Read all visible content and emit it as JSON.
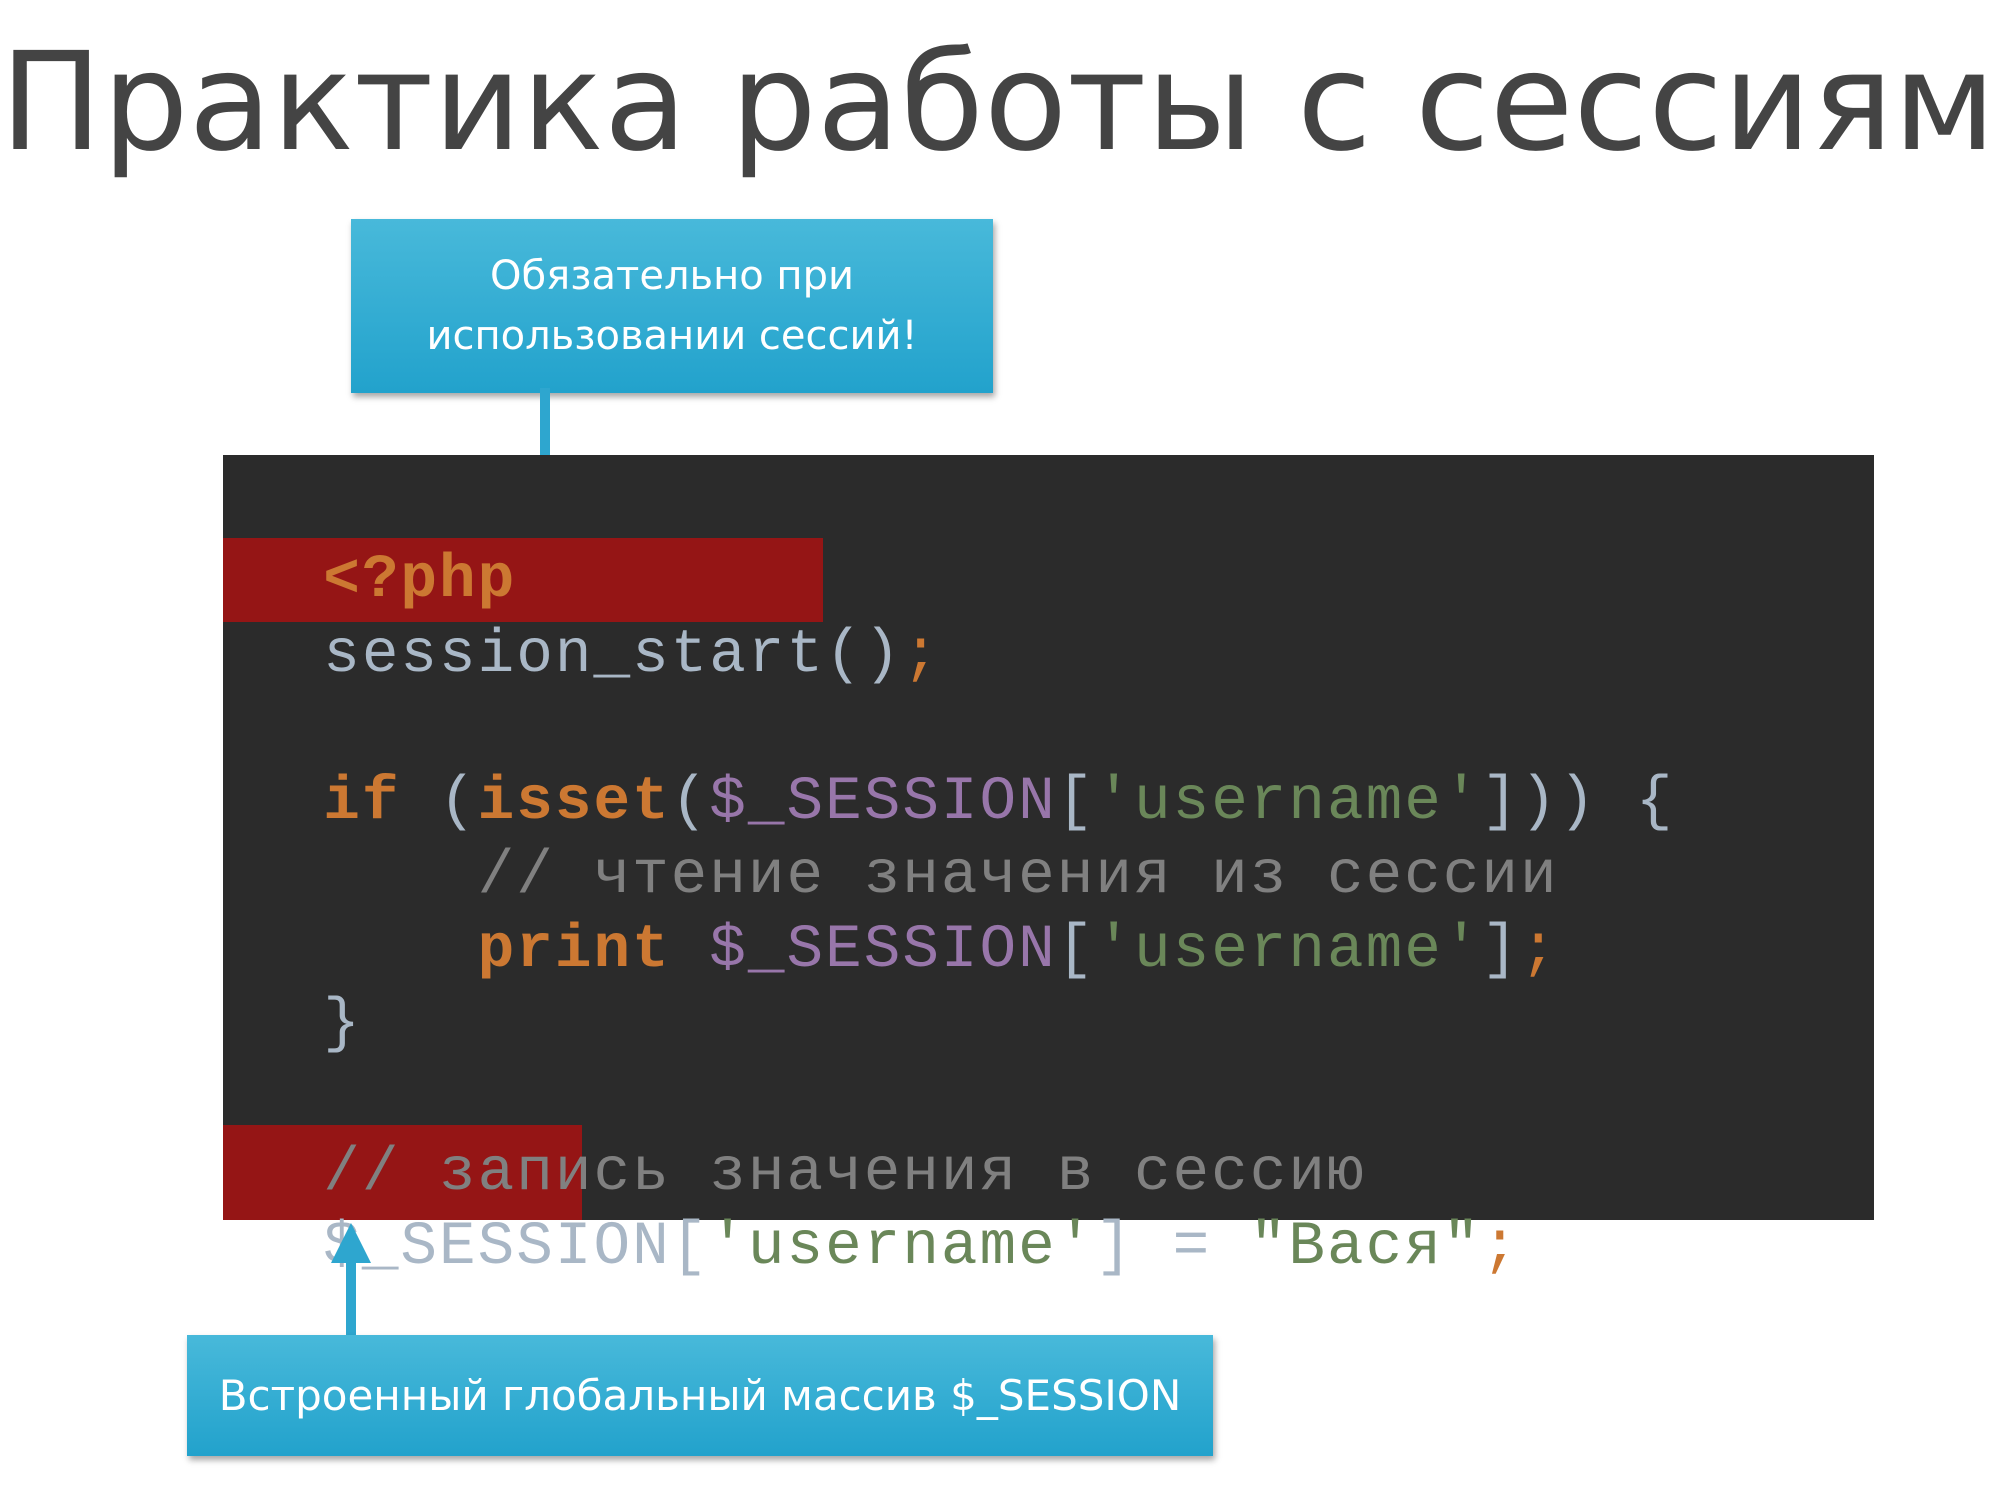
{
  "title": "Практика работы с сессиями",
  "callout_top": {
    "line1": "Обязательно при",
    "line2": "использовании сессий!"
  },
  "callout_bottom": {
    "text": "Встроенный глобальный массив $_SESSION"
  },
  "code": {
    "php_open": "<?php",
    "session_start": "session_start()",
    "semicolon": ";",
    "if_kw": "if",
    "paren_open": " (",
    "isset_kw": "isset",
    "paren_open2": "(",
    "session_var": "$_SESSION",
    "bracket_open": "[",
    "username_str": "'username'",
    "close_if": "])) {",
    "comment_read": "    // чтение значения из сессии",
    "indent": "    ",
    "print_kw": "print",
    "space": " ",
    "bracket_close": "]",
    "close_brace": "}",
    "comment_write": "// запись значения в сессию",
    "assign": "] = ",
    "vasya_str": "\"Вася\""
  },
  "colors": {
    "panel_bg": "#2b2b2b",
    "highlight": "#951515",
    "callout": "#2fa9d2",
    "arrow": "#2ea6cf"
  }
}
